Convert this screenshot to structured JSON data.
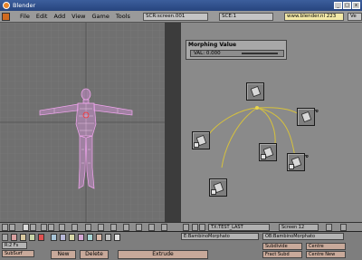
{
  "window": {
    "title": "Blender",
    "minimize": "_",
    "maximize": "□",
    "close": "x"
  },
  "menubar": {
    "items": [
      "File",
      "Edit",
      "Add",
      "View",
      "Game",
      "Tools"
    ],
    "screen": "SCR:screen.001",
    "scene": "SCE:1",
    "url": "www.blender.nl  223",
    "version": "Ve"
  },
  "oops": {
    "morph_panel": {
      "title": "Morphing Value",
      "slider_label": "VAL: 0.000",
      "value": 0.0
    },
    "node_tags": [
      "P",
      "P"
    ],
    "link_color": "#d7c23c"
  },
  "headers": {
    "oops_name": "TX:TEST_LAST",
    "screen_num": "Screen 12"
  },
  "buttons": {
    "row1": {
      "edit_field": "R:2  Fs",
      "ob_field": "E:BambinoMorphato",
      "me_field": "OB:BambinoMorphato"
    },
    "subsurf": "SubSurf",
    "new": "New",
    "delete": "Delete",
    "extrude": "Extrude",
    "subdivide": "Subdivide",
    "fract_subd": "Fract Subd",
    "centre": "Centre",
    "centre_new": "Centre New"
  },
  "colors": {
    "mesh": "#f3a6f0",
    "viewport_bg": "#707070",
    "oops_bg": "#8a8a8a",
    "accent": "#d06a20"
  }
}
